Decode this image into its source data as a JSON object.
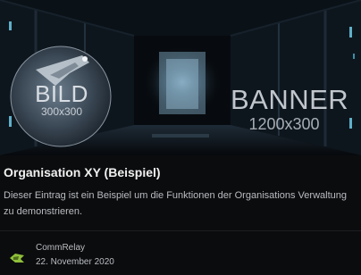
{
  "banner": {
    "image_label": "BILD",
    "image_size": "300x300",
    "banner_label": "BANNER",
    "banner_size": "1200x300"
  },
  "entry": {
    "title": "Organisation XY (Beispiel)",
    "description": "Dieser Eintrag ist ein Beispiel um die Funktionen der Organisations Verwaltung zu demonstrieren."
  },
  "author": {
    "name": "CommRelay",
    "date": "22. November 2020",
    "icon": "ship-icon"
  },
  "colors": {
    "background": "#0b0c0e",
    "title": "#f0f0f0",
    "text": "#b9bcc0",
    "accent": "#8fbf3a"
  }
}
